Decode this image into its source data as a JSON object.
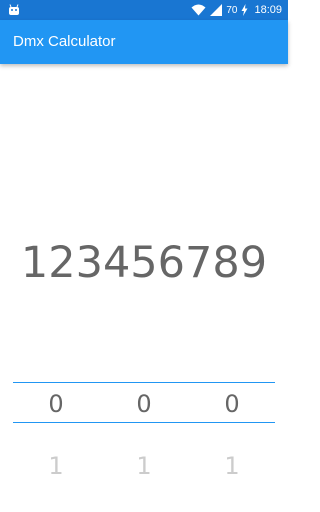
{
  "status_bar": {
    "battery": "70",
    "time": "18:09",
    "bg_color": "#1976d2"
  },
  "app_bar": {
    "title": "Dmx Calculator",
    "color": "#2196f3"
  },
  "display": {
    "value": "123456789"
  },
  "pickers": [
    {
      "selected": "0",
      "next": "1"
    },
    {
      "selected": "0",
      "next": "1"
    },
    {
      "selected": "0",
      "next": "1"
    }
  ]
}
